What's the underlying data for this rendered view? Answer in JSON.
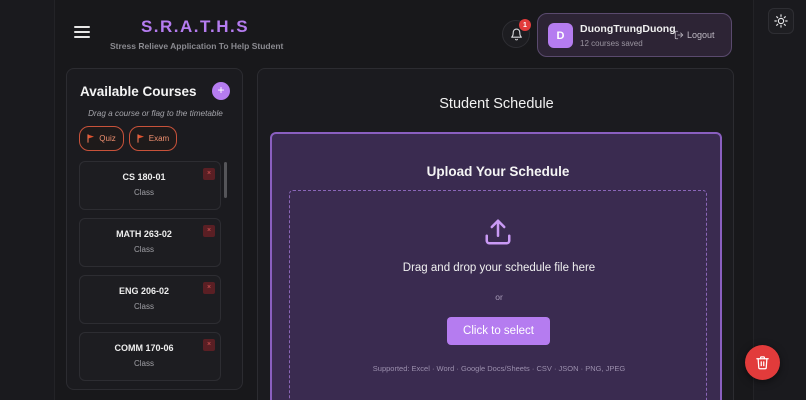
{
  "header": {
    "brand_title": "S.R.A.T.H.S",
    "brand_subtitle": "Stress Relieve Application To Help Student",
    "notification_count": "1",
    "user": {
      "avatar_initial": "D",
      "name": "DuongTrungDuong",
      "courses_saved": "12 courses saved",
      "logout_label": "Logout"
    }
  },
  "icons": {
    "menu": "hamburger-icon",
    "notifications": "bell-icon",
    "logout": "logout-icon",
    "theme": "sun-icon",
    "add": "plus-icon",
    "flag": "flag-icon",
    "remove": "close-icon",
    "upload": "upload-icon",
    "delete": "trash-icon"
  },
  "sidebar": {
    "title": "Available Courses",
    "add_label": "+",
    "hint": "Drag a course or flag to the timetable",
    "flags": [
      {
        "label": "Quiz"
      },
      {
        "label": "Exam"
      }
    ],
    "courses": [
      {
        "code": "CS 180-01",
        "type": "Class"
      },
      {
        "code": "MATH 263-02",
        "type": "Class"
      },
      {
        "code": "ENG 206-02",
        "type": "Class"
      },
      {
        "code": "COMM 170-06",
        "type": "Class"
      }
    ],
    "remove_label": "×"
  },
  "main": {
    "title": "Student Schedule",
    "upload": {
      "title": "Upload Your Schedule",
      "drop_text": "Drag and drop your schedule file here",
      "or_text": "or",
      "button_label": "Click to select",
      "supported": "Supported: Excel · Word · Google Docs/Sheets · CSV · JSON · PNG, JPEG"
    }
  },
  "colors": {
    "accent": "#b57cf0",
    "danger": "#e23b3b",
    "flag": "#e0522e",
    "background": "#18181b",
    "upload_panel": "#3a2b50"
  }
}
